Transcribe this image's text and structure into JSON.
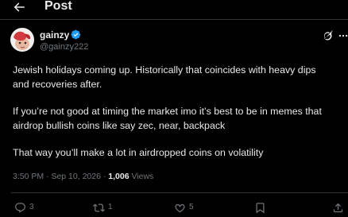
{
  "header": {
    "title": "Post",
    "back_icon": "arrow-left-icon"
  },
  "author": {
    "name": "gainzy",
    "handle": "@gainzy222",
    "verified": true,
    "verified_color": "#1d9bf0"
  },
  "post": {
    "paragraphs": [
      "Jewish holidays coming up. Historically that coincides with heavy dips",
      "and recoveries after.",
      "If you’re not good at timing the market imo it’s best to be in memes that",
      "airdrop bullish coins like say zec, near, backpack",
      "That way you’ll make a lot in airdropped coins on volatility"
    ]
  },
  "meta": {
    "time": "3:50 PM",
    "separator": " · ",
    "date": "Sep 10, 2026",
    "views_count": "1,006",
    "views_label": " Views"
  },
  "actions": {
    "replies": "3",
    "reposts": "1",
    "likes": "5",
    "bookmark_icon": "bookmark-icon",
    "share_icon": "share-icon"
  },
  "colors": {
    "background": "#000000",
    "text": "#e7e9ea",
    "secondary": "#71767b",
    "divider": "#2f3336",
    "accent": "#1d9bf0"
  }
}
